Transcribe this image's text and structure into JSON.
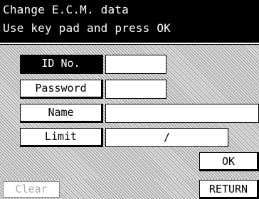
{
  "header": {
    "line1": "Change E.C.M. data",
    "line2": "Use key pad and press OK"
  },
  "form": {
    "id_label": "ID No.",
    "id_value": "",
    "password_label": "Password",
    "password_value": "",
    "name_label": "Name",
    "name_value": "",
    "limit_label": "Limit",
    "limit_value": "/"
  },
  "buttons": {
    "ok": "OK",
    "clear": "Clear",
    "return": "RETURN"
  }
}
